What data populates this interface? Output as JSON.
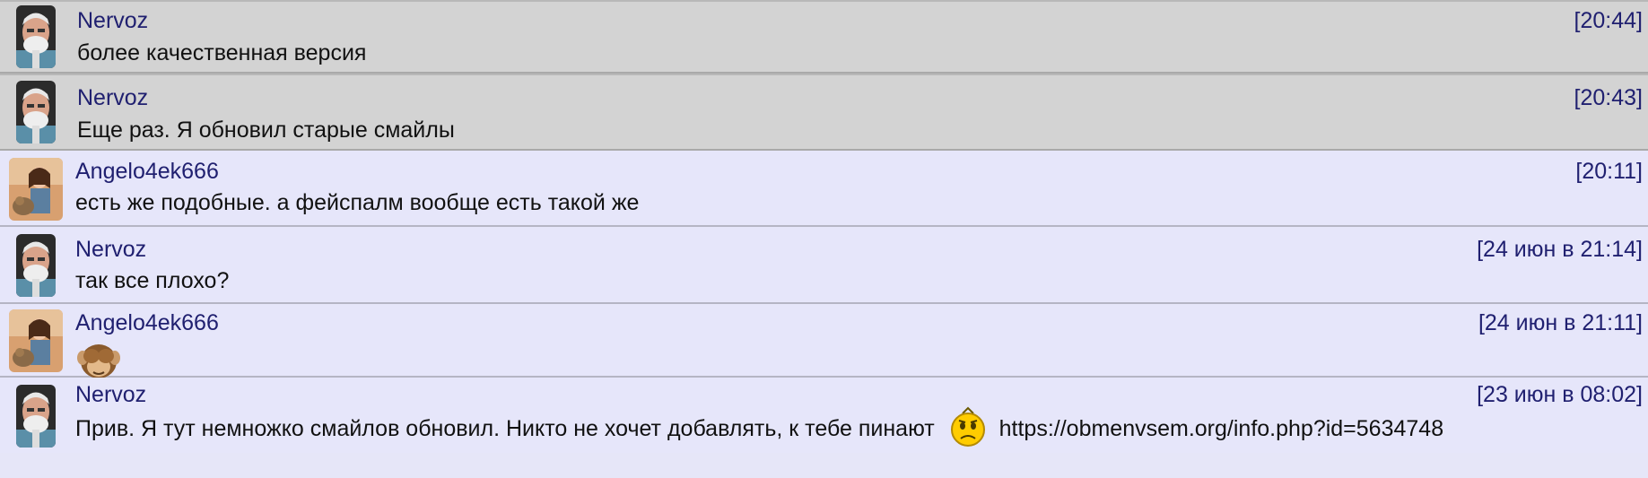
{
  "messages": [
    {
      "author": "Nervoz",
      "time": "[20:44]",
      "text": "более качественная версия",
      "state": "read",
      "avatar": "old-man-avatar-icon"
    },
    {
      "author": "Nervoz",
      "time": "[20:43]",
      "text": "Еще раз. Я обновил старые смайлы",
      "state": "read",
      "avatar": "old-man-avatar-icon"
    },
    {
      "author": "Angelo4ek666",
      "time": "[20:11]",
      "text": "есть же подобные. а фейспалм вообще есть такой же",
      "state": "unread",
      "avatar": "girl-avatar-icon"
    },
    {
      "author": "Nervoz",
      "time": "[24 июн в 21:14]",
      "text": "так все плохо?",
      "state": "unread",
      "avatar": "old-man-avatar-icon"
    },
    {
      "author": "Angelo4ek666",
      "time": "[24 июн в 21:11]",
      "emoji": "see-no-evil-monkey-icon",
      "state": "unread",
      "avatar": "girl-avatar-icon"
    },
    {
      "author": "Nervoz",
      "time": "[23 июн в 08:02]",
      "text": "Прив. Я тут немножко смайлов обновил. Никто не хочет добавлять, к тебе пинают",
      "smiley": "sad-smiley-icon",
      "link": "https://obmenvsem.org/info.php?id=5634748",
      "state": "unread",
      "avatar": "old-man-avatar-icon"
    }
  ],
  "colors": {
    "read_bg": "#d3d3d3",
    "unread_bg": "#e6e6fa",
    "author_color": "#202070",
    "text_color": "#111111"
  }
}
